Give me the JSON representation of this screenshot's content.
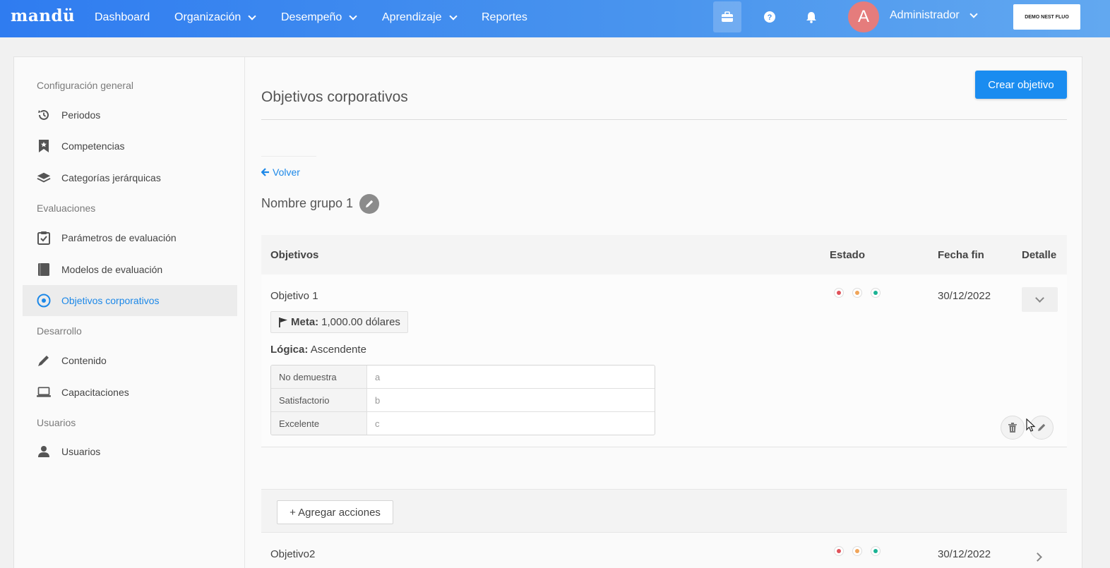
{
  "topbar": {
    "logo": "mandü",
    "nav": [
      {
        "label": "Dashboard",
        "has_dropdown": false
      },
      {
        "label": "Organización",
        "has_dropdown": true
      },
      {
        "label": "Desempeño",
        "has_dropdown": true
      },
      {
        "label": "Aprendizaje",
        "has_dropdown": true
      },
      {
        "label": "Reportes",
        "has_dropdown": false
      }
    ],
    "icons": [
      "briefcase-icon",
      "help-icon",
      "bell-icon"
    ],
    "avatar_initial": "A",
    "user_name": "Administrador",
    "company_logo_text": "DEMO NEST FLUO"
  },
  "sidebar": {
    "sections": [
      {
        "title": "Configuración general",
        "items": [
          {
            "label": "Periodos",
            "icon": "history-icon"
          },
          {
            "label": "Competencias",
            "icon": "bookmark-star-icon"
          },
          {
            "label": "Categorías jerárquicas",
            "icon": "layers-icon"
          }
        ]
      },
      {
        "title": "Evaluaciones",
        "items": [
          {
            "label": "Parámetros de evaluación",
            "icon": "clipboard-check-icon"
          },
          {
            "label": "Modelos de evaluación",
            "icon": "book-icon"
          },
          {
            "label": "Objetivos corporativos",
            "icon": "target-icon",
            "active": true
          }
        ]
      },
      {
        "title": "Desarrollo",
        "items": [
          {
            "label": "Contenido",
            "icon": "pencil-icon"
          },
          {
            "label": "Capacitaciones",
            "icon": "laptop-icon"
          }
        ]
      },
      {
        "title": "Usuarios",
        "items": [
          {
            "label": "Usuarios",
            "icon": "user-icon"
          }
        ]
      }
    ]
  },
  "main": {
    "title": "Objetivos corporativos",
    "create_button": "Crear objetivo",
    "back_link": "Volver",
    "group_name": "Nombre grupo 1",
    "table": {
      "headers": [
        "Objetivos",
        "Estado",
        "Fecha fin",
        "Detalle"
      ],
      "rows": [
        {
          "name": "Objetivo 1",
          "end_date": "30/12/2022",
          "expanded": true,
          "meta_label": "Meta:",
          "meta_value": "1,000.00 dólares",
          "logic_label": "Lógica:",
          "logic_value": "Ascendente",
          "scale": [
            {
              "label": "No demuestra",
              "value": "a"
            },
            {
              "label": "Satisfactorio",
              "value": "b"
            },
            {
              "label": "Excelente",
              "value": "c"
            }
          ]
        },
        {
          "name": "Objetivo2",
          "end_date": "30/12/2022",
          "expanded": false
        }
      ]
    },
    "add_actions_button": "+ Agregar acciones"
  },
  "colors": {
    "primary": "#1a8cf0",
    "status_red": "#e0525a",
    "status_orange": "#f0a55a",
    "status_green": "#1ab394"
  }
}
